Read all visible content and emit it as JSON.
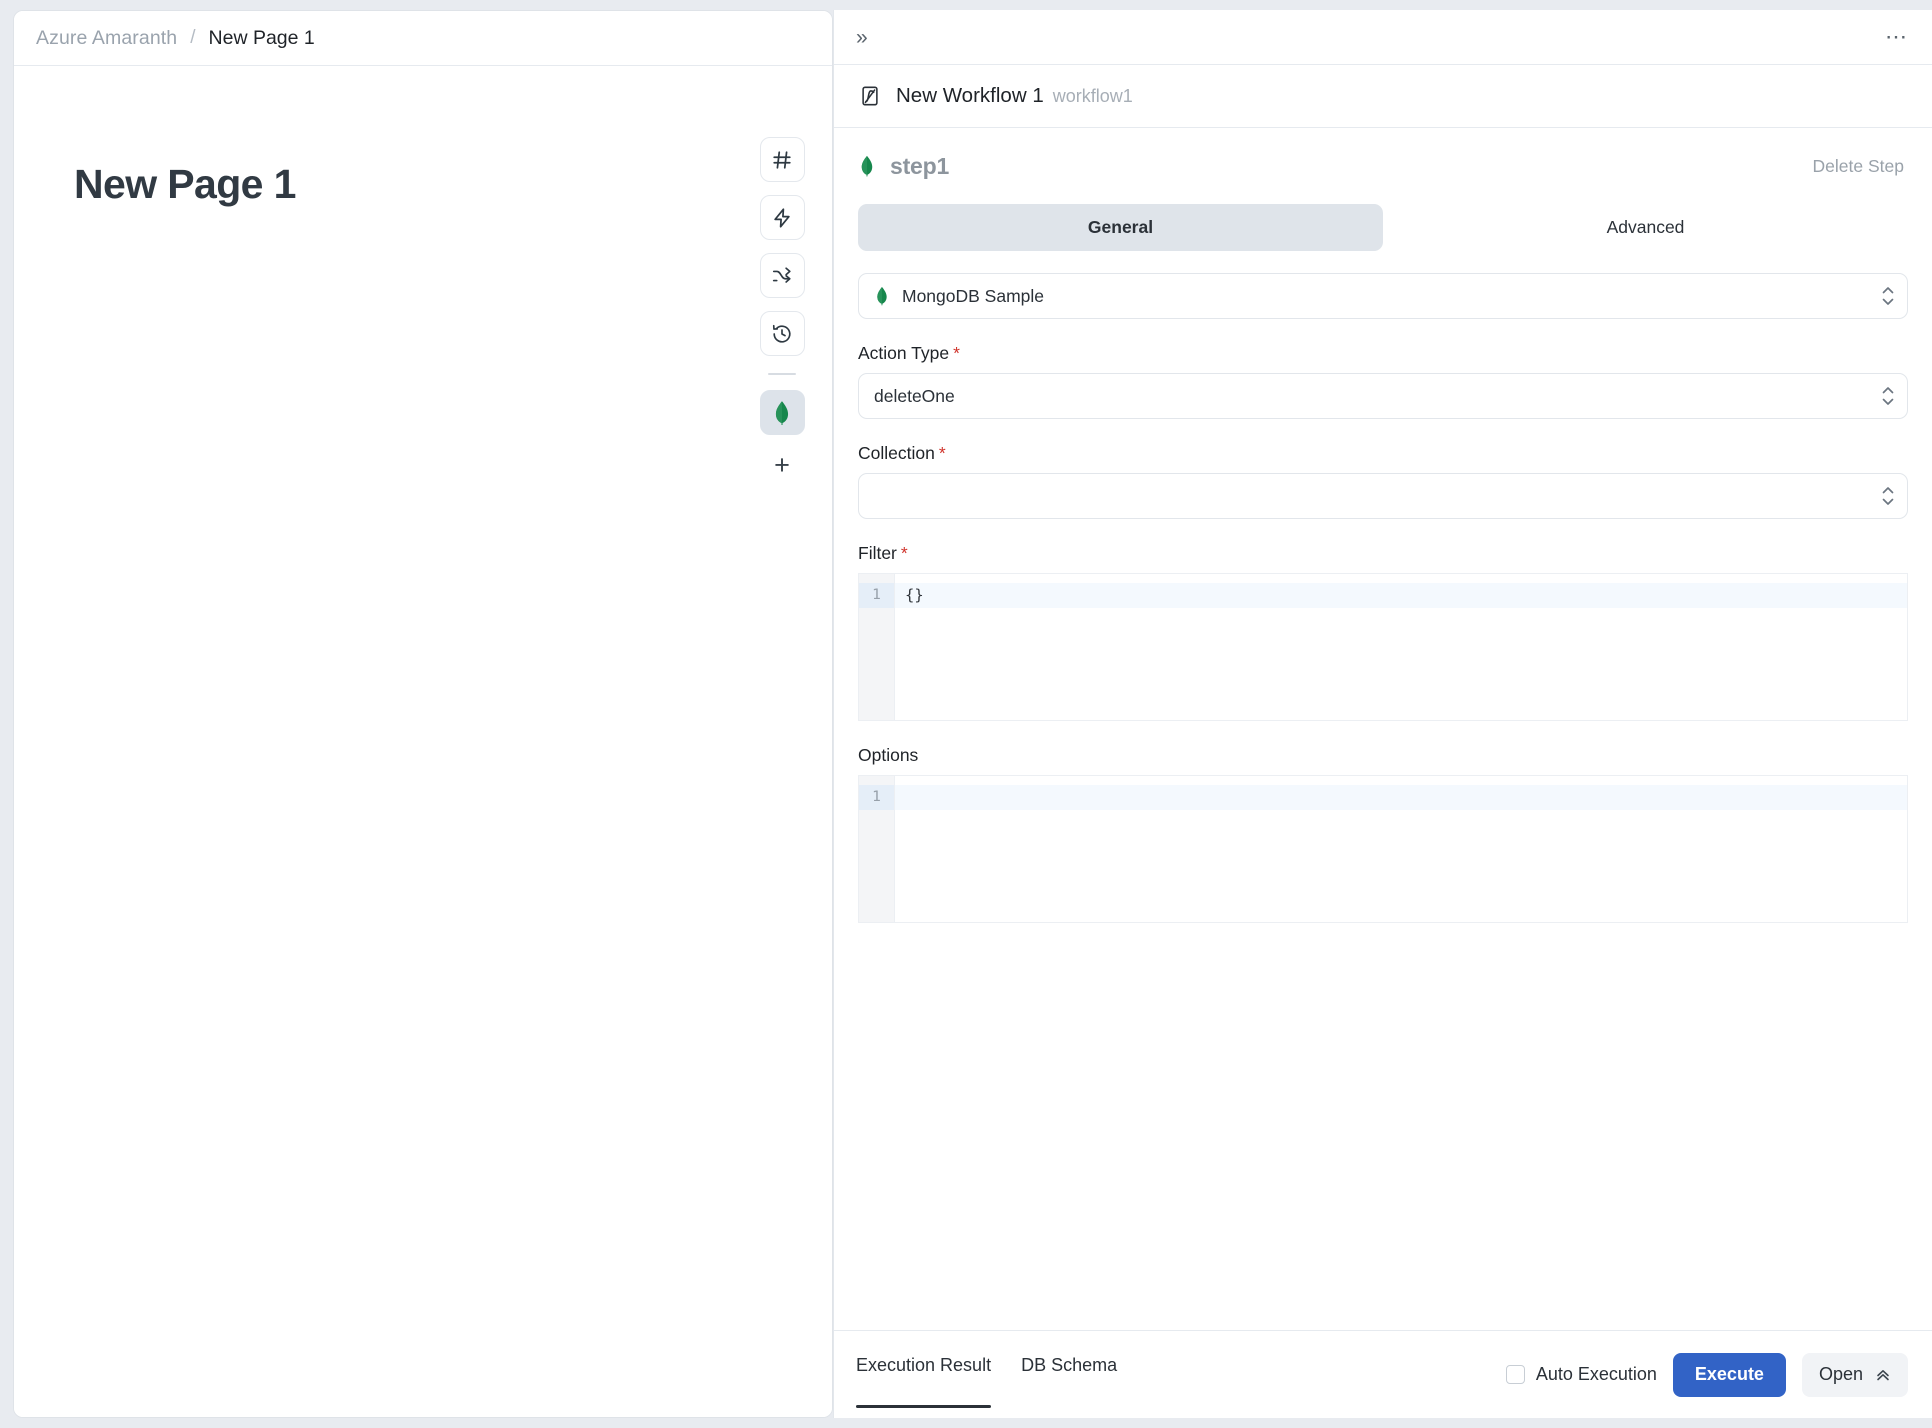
{
  "breadcrumb": {
    "workspace": "Azure Amaranth",
    "separator": "/",
    "current": "New Page 1"
  },
  "page": {
    "title": "New Page 1"
  },
  "left_toolbar": {
    "items": [
      {
        "name": "hash-icon",
        "label": "#"
      },
      {
        "name": "lightning-icon",
        "label": ""
      },
      {
        "name": "branch-icon",
        "label": ""
      },
      {
        "name": "history-icon",
        "label": ""
      }
    ],
    "active_item": "mongodb-leaf-icon",
    "add_label": "+"
  },
  "right_panel": {
    "expand_icon": "»",
    "more_icon": "⋯",
    "workflow": {
      "name": "New Workflow 1",
      "slug": "workflow1"
    },
    "step": {
      "name": "step1",
      "delete_label": "Delete Step"
    },
    "tabs": [
      {
        "label": "General",
        "active": true
      },
      {
        "label": "Advanced",
        "active": false
      }
    ],
    "form": {
      "datasource": {
        "value": "MongoDB Sample",
        "icon": "mongodb-leaf-icon"
      },
      "action_type": {
        "label": "Action Type",
        "required": "*",
        "value": "deleteOne"
      },
      "collection": {
        "label": "Collection",
        "required": "*",
        "value": ""
      },
      "filter": {
        "label": "Filter",
        "required": "*",
        "line_number": "1",
        "code": "{}"
      },
      "options": {
        "label": "Options",
        "line_number": "1",
        "code": ""
      }
    }
  },
  "bottom_bar": {
    "tabs": [
      {
        "label": "Execution Result",
        "active": true
      },
      {
        "label": "DB Schema",
        "active": false
      }
    ],
    "auto_execution_label": "Auto Execution",
    "auto_execution_checked": false,
    "execute_label": "Execute",
    "open_label": "Open"
  },
  "colors": {
    "accent_blue": "#3263c6",
    "mongodb_green": "#13a05c",
    "required_red": "#d0342c",
    "tab_active_bg": "#dfe4ea"
  }
}
